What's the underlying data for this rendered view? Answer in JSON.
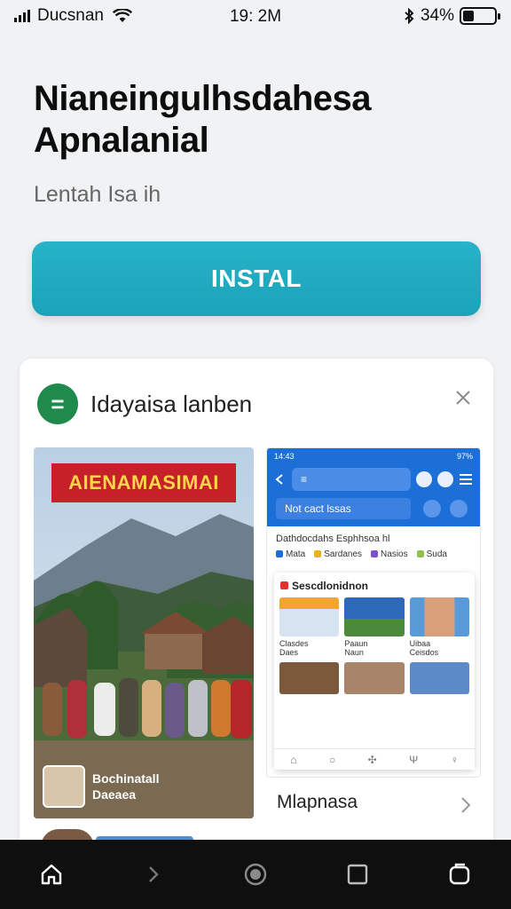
{
  "status_bar": {
    "carrier": "Ducsnan",
    "time": "19: 2M",
    "battery_text": "34%",
    "battery_level": 0.34,
    "icons": [
      "signal-icon",
      "wifi-icon",
      "bluetooth-icon",
      "battery-icon"
    ]
  },
  "header": {
    "title": "Nianeingulhsdahesa Apnalanial",
    "subtitle": "Lentah Isa ih",
    "install_label": "INSTAL"
  },
  "card": {
    "app_name": "Idayaisa lanben",
    "photo": {
      "banner": "AIENAMASIMAI",
      "caption_line1": "Bochinatall",
      "caption_line2": "Daeaea"
    },
    "phone_mock": {
      "status_time": "14:43",
      "status_right": "97%",
      "search_text": "≡",
      "field_text": "Not cact lssas",
      "line1": "Dathdocdahs Esphhsoa hl",
      "chips": [
        "Mata",
        "Sardanes",
        "Nasios",
        "Suda"
      ],
      "panel_title": "Sescdlonidnon",
      "items": [
        "Clasdes",
        "Paaun",
        "Uibaa"
      ],
      "items_sub": [
        "Daes",
        "Naun",
        "Ceisdos"
      ]
    },
    "list_label": "Mlapnasa"
  },
  "colors": {
    "install_button": "#1fa9bf",
    "app_icon": "#1f8a4c",
    "banner_bg": "#c62028",
    "phone_header": "#1d6fd8"
  }
}
